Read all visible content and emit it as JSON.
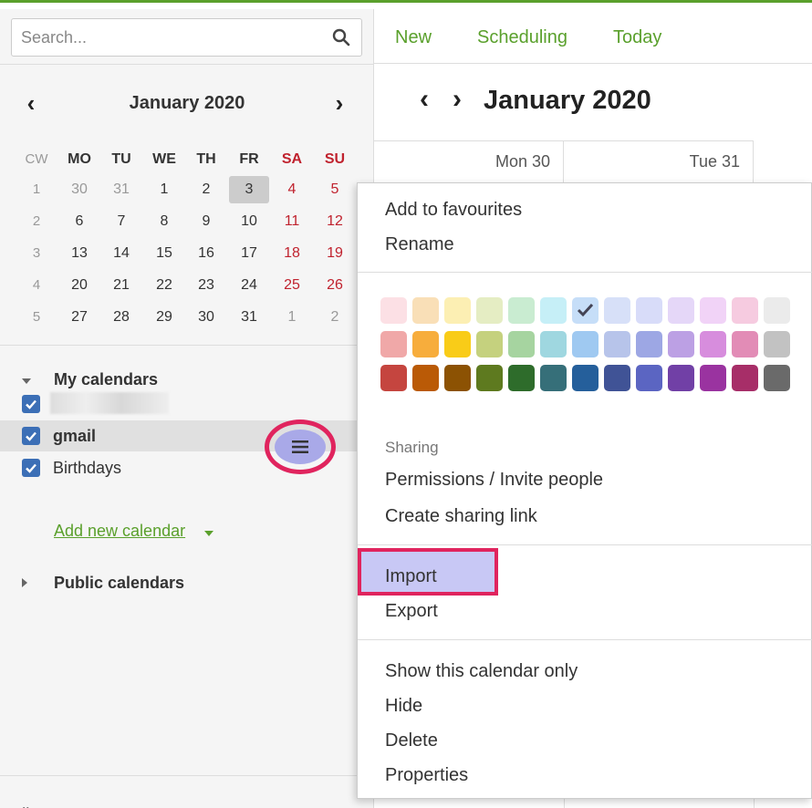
{
  "search": {
    "placeholder": "Search..."
  },
  "mini_calendar": {
    "title": "January 2020",
    "cw_label": "CW",
    "weekdays": [
      "MO",
      "TU",
      "WE",
      "TH",
      "FR",
      "SA",
      "SU"
    ],
    "weeks": [
      {
        "cw": "1",
        "days": [
          "30",
          "31",
          "1",
          "2",
          "3",
          "4",
          "5"
        ]
      },
      {
        "cw": "2",
        "days": [
          "6",
          "7",
          "8",
          "9",
          "10",
          "11",
          "12"
        ]
      },
      {
        "cw": "3",
        "days": [
          "13",
          "14",
          "15",
          "16",
          "17",
          "18",
          "19"
        ]
      },
      {
        "cw": "4",
        "days": [
          "20",
          "21",
          "22",
          "23",
          "24",
          "25",
          "26"
        ]
      },
      {
        "cw": "5",
        "days": [
          "27",
          "28",
          "29",
          "30",
          "31",
          "1",
          "2"
        ]
      }
    ]
  },
  "my_calendars": {
    "title": "My calendars",
    "items": [
      {
        "label": "",
        "checked": true
      },
      {
        "label": "gmail",
        "checked": true
      },
      {
        "label": "Birthdays",
        "checked": true
      }
    ],
    "add_label": "Add new calendar"
  },
  "public_calendars": {
    "title": "Public calendars"
  },
  "collapse_label": "«",
  "toolbar": {
    "new": "New",
    "scheduling": "Scheduling",
    "today": "Today"
  },
  "main": {
    "title": "January 2020",
    "days": [
      "Mon 30",
      "Tue 31"
    ]
  },
  "context_menu": {
    "add_fav": "Add to favourites",
    "rename": "Rename",
    "sharing_title": "Sharing",
    "permissions": "Permissions / Invite people",
    "create_link": "Create sharing link",
    "import": "Import",
    "export": "Export",
    "show_only": "Show this calendar only",
    "hide": "Hide",
    "delete": "Delete",
    "properties": "Properties",
    "colors": [
      [
        "#fce0e5",
        "#f9dfb7",
        "#fcefb3",
        "#e5edc3",
        "#c9ecd1",
        "#c6eff7",
        "#c6def8",
        "#d7e0f8",
        "#d8dcf9",
        "#e5d7f8",
        "#f1d3f7",
        "#f6cbe0",
        "#ebebeb"
      ],
      [
        "#f0a8a8",
        "#f7ad3c",
        "#f9cc18",
        "#c5d17e",
        "#a6d4a0",
        "#9fd7e0",
        "#9fc9f1",
        "#b7c4ea",
        "#9da7e4",
        "#bca0e4",
        "#d78ddd",
        "#e28cb6",
        "#c2c2c2"
      ],
      [
        "#c5453f",
        "#ba5a06",
        "#8c5203",
        "#5e7a1f",
        "#2e6c2b",
        "#366f79",
        "#255f9b",
        "#405396",
        "#5b65c2",
        "#7140a6",
        "#9a33a0",
        "#a72e68",
        "#6a6a6a"
      ]
    ],
    "selected_color": "#c6def8"
  }
}
